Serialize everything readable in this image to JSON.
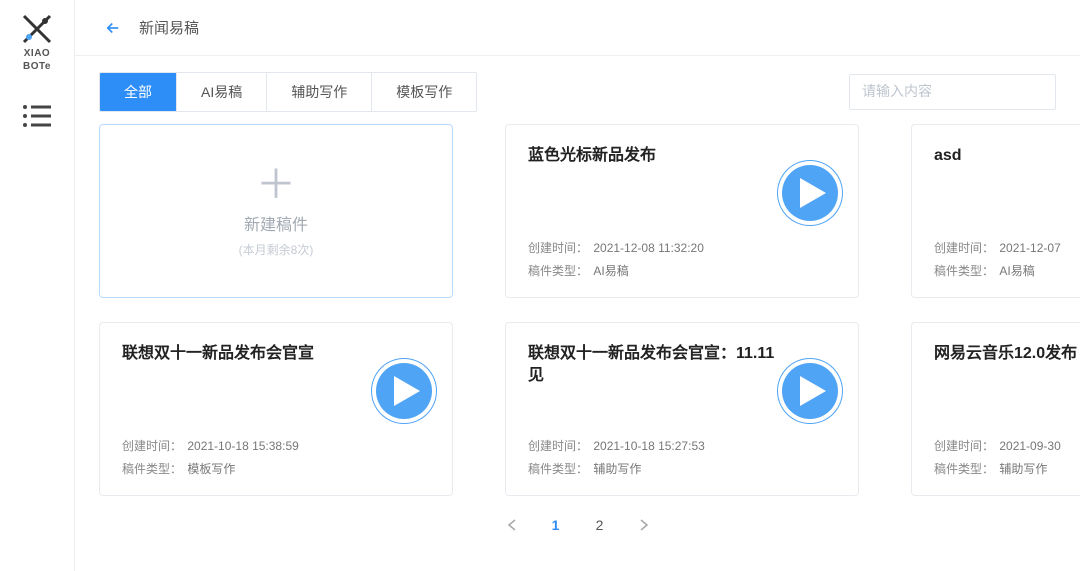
{
  "brand": {
    "name": "XIAO BOTE",
    "line1": "XIAO",
    "line2": "BOTe"
  },
  "header": {
    "breadcrumb": "新闻易稿"
  },
  "tabs": [
    {
      "label": "全部",
      "active": true
    },
    {
      "label": "AI易稿",
      "active": false
    },
    {
      "label": "辅助写作",
      "active": false
    },
    {
      "label": "模板写作",
      "active": false
    }
  ],
  "search": {
    "placeholder": "请输入内容"
  },
  "create": {
    "label": "新建稿件",
    "sub": "(本月剩余8次)"
  },
  "meta_labels": {
    "created": "创建时间：",
    "type": "稿件类型："
  },
  "cards": [
    {
      "title": "蓝色光标新品发布",
      "created": "2021-12-08 11:32:20",
      "type": "AI易稿",
      "play": true
    },
    {
      "title": "asd",
      "created": "2021-12-07",
      "type": "AI易稿",
      "play": false
    },
    {
      "title": "联想双十一新品发布会官宣",
      "created": "2021-10-18 15:38:59",
      "type": "模板写作",
      "play": true
    },
    {
      "title": "联想双十一新品发布会官宣：11.11见",
      "created": "2021-10-18 15:27:53",
      "type": "辅助写作",
      "play": true
    },
    {
      "title": "网易云音乐12.0发布",
      "created": "2021-09-30",
      "type": "辅助写作",
      "play": false
    }
  ],
  "pagination": {
    "pages": [
      "1",
      "2"
    ],
    "current": "1"
  }
}
